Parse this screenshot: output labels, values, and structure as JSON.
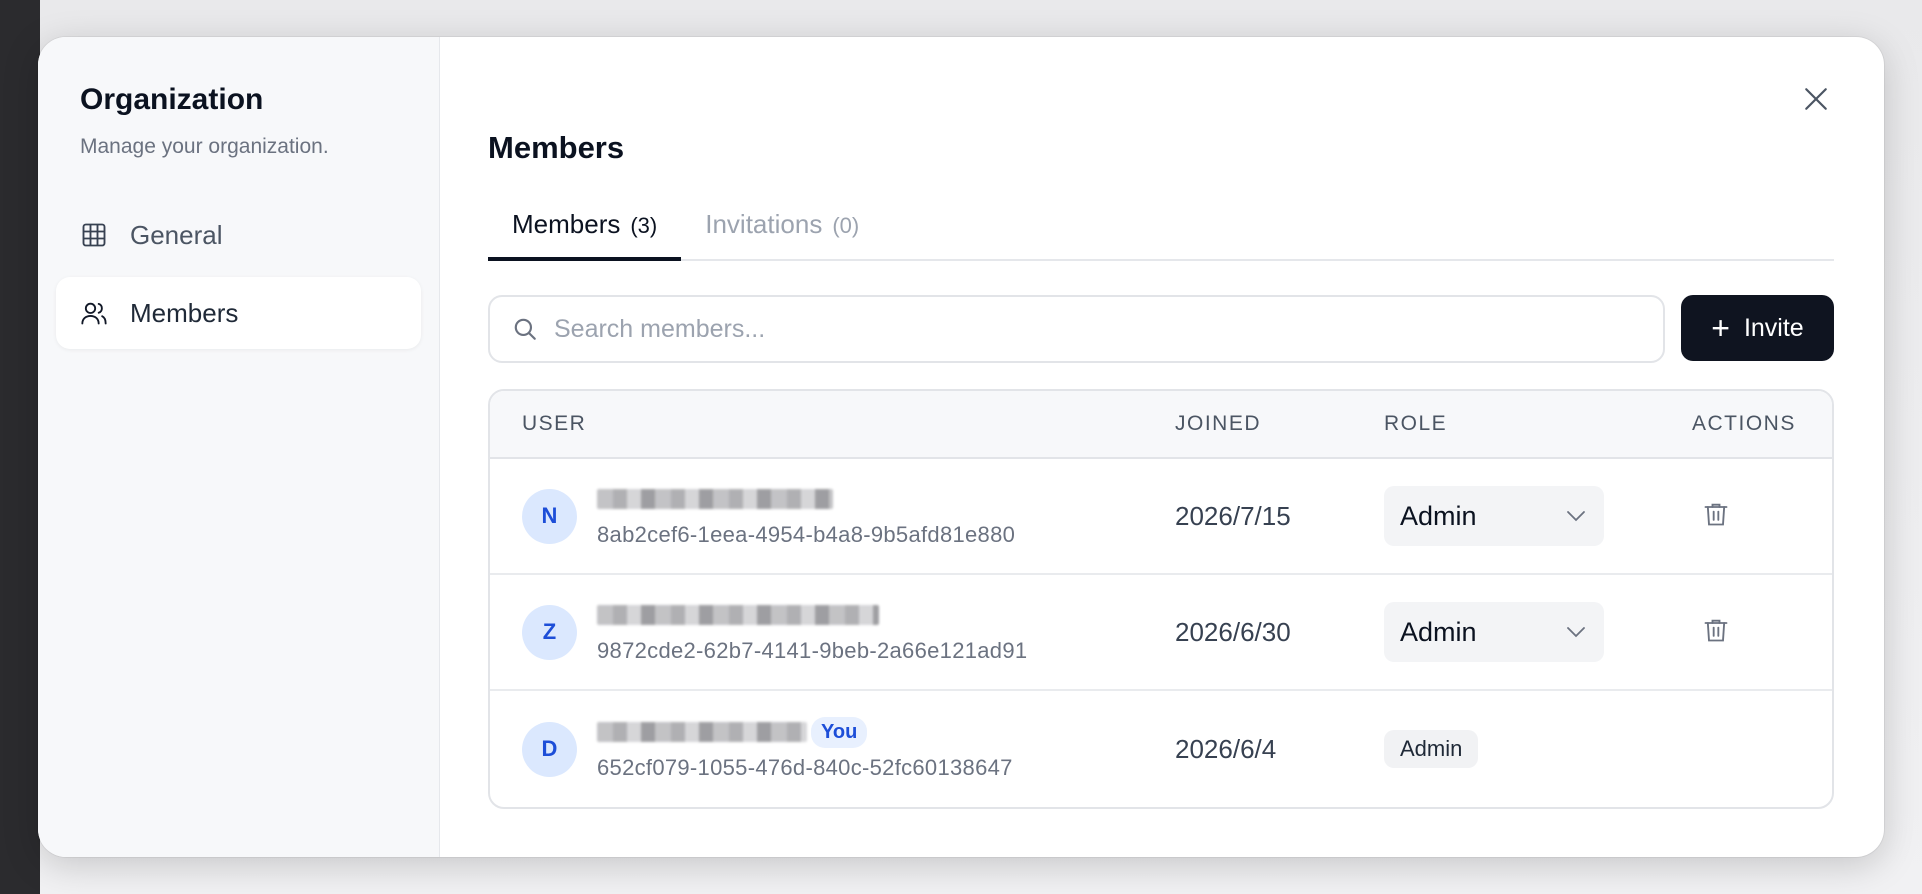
{
  "sidebar": {
    "title": "Organization",
    "subtitle": "Manage your organization.",
    "items": [
      {
        "label": "General",
        "icon": "grid-icon",
        "active": false
      },
      {
        "label": "Members",
        "icon": "users-icon",
        "active": true
      }
    ]
  },
  "main": {
    "title": "Members",
    "tabs": [
      {
        "label": "Members",
        "count": "(3)",
        "active": true
      },
      {
        "label": "Invitations",
        "count": "(0)",
        "active": false
      }
    ],
    "search": {
      "placeholder": "Search members...",
      "value": ""
    },
    "invite_label": "Invite",
    "table": {
      "headers": {
        "user": "USER",
        "joined": "JOINED",
        "role": "ROLE",
        "actions": "ACTIONS"
      },
      "rows": [
        {
          "initial": "N",
          "id": "8ab2cef6-1eea-4954-b4a8-9b5afd81e880",
          "joined": "2026/7/15",
          "role": "Admin",
          "editable": true,
          "you": ""
        },
        {
          "initial": "Z",
          "id": "9872cde2-62b7-4141-9beb-2a66e121ad91",
          "joined": "2026/6/30",
          "role": "Admin",
          "editable": true,
          "you": ""
        },
        {
          "initial": "D",
          "id": "652cf079-1055-476d-840c-52fc60138647",
          "joined": "2026/6/4",
          "role": "Admin",
          "editable": false,
          "you": "You"
        }
      ]
    }
  },
  "colors": {
    "accent_dark": "#0f1420",
    "avatar_bg": "#dbe8fe",
    "avatar_text": "#1d4ed8"
  }
}
